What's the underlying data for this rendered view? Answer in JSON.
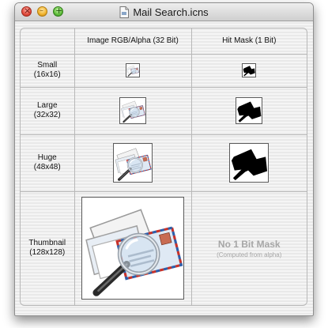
{
  "window": {
    "title": "Mail Search.icns",
    "controls": [
      "close",
      "minimize",
      "zoom"
    ]
  },
  "table": {
    "columns": [
      "",
      "Image RGB/Alpha (32 Bit)",
      "Hit Mask (1 Bit)"
    ],
    "rows": [
      {
        "name": "Small",
        "size": "(16x16)"
      },
      {
        "name": "Large",
        "size": "(32x32)"
      },
      {
        "name": "Huge",
        "size": "(48x48)"
      },
      {
        "name": "Thumbnail",
        "size": "(128x128)"
      }
    ],
    "no_mask": {
      "title": "No 1 Bit Mask",
      "subtitle": "(Computed from alpha)"
    }
  },
  "icons": {
    "image": "mail-search-icon",
    "mask": "hit-mask-silhouette"
  }
}
